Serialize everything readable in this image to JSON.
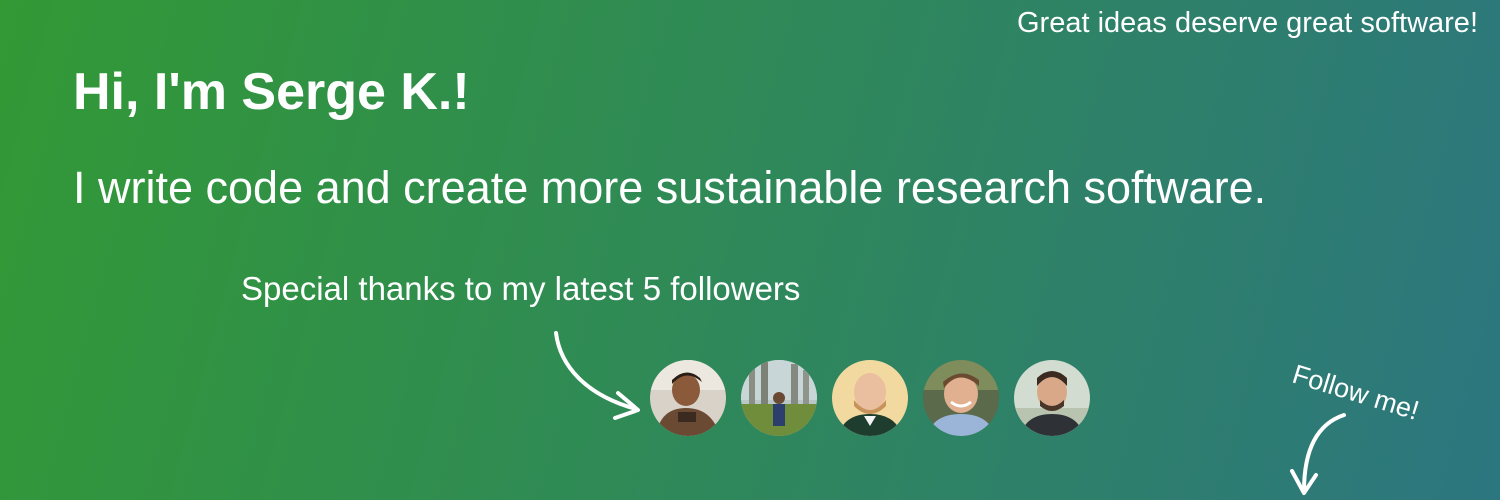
{
  "banner": {
    "tagline": "Great ideas deserve great software!",
    "greeting": "Hi, I'm Serge K.!",
    "subtitle": "I write code and create more sustainable research software.",
    "thanks": "Special thanks to my latest 5 followers",
    "follow_cta": "Follow me!",
    "colors": {
      "gradient_start": "#329935",
      "gradient_end": "#2c7680",
      "text": "#ffffff"
    },
    "followers": [
      {
        "icon": "follower-avatar-1"
      },
      {
        "icon": "follower-avatar-2"
      },
      {
        "icon": "follower-avatar-3"
      },
      {
        "icon": "follower-avatar-4"
      },
      {
        "icon": "follower-avatar-5"
      }
    ]
  }
}
